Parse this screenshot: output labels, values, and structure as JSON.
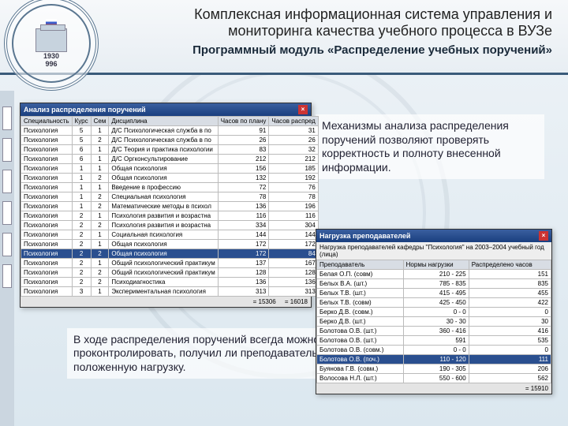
{
  "header": {
    "title": "Комплексная информационная система управления и мониторинга качества учебного процесса в ВУЗе",
    "subtitle": "Программный модуль «Распределение учебных поручений»",
    "emblem_year1": "1930",
    "emblem_year2": "996"
  },
  "desc1": "Механизмы анализа распределения поручений позволяют проверять корректность и полноту внесенной информации.",
  "desc2": "В ходе распределения поручений всегда можно проконтролировать, получил ли преподаватель положенную нагрузку.",
  "win1": {
    "title": "Анализ распределения поручений",
    "close": "×",
    "cols": [
      "Специальность",
      "Курс",
      "Сем",
      "Дисциплина",
      "Часов по плану",
      "Часов распред"
    ],
    "rows": [
      [
        "Психология",
        "5",
        "1",
        "Д/С Психологическая служба в по",
        "91",
        "31"
      ],
      [
        "Психология",
        "5",
        "2",
        "Д/С Психологическая служба в по",
        "26",
        "26"
      ],
      [
        "Психология",
        "6",
        "1",
        "Д/С Теория и практика психологии",
        "83",
        "32"
      ],
      [
        "Психология",
        "6",
        "1",
        "Д/С Оргконсультирование",
        "212",
        "212"
      ],
      [
        "Психология",
        "1",
        "1",
        "Общая психология",
        "156",
        "185"
      ],
      [
        "Психология",
        "1",
        "2",
        "Общая психология",
        "132",
        "192"
      ],
      [
        "Психология",
        "1",
        "1",
        "Введение в профессию",
        "72",
        "76"
      ],
      [
        "Психология",
        "1",
        "2",
        "Специальная психология",
        "78",
        "78"
      ],
      [
        "Психология",
        "1",
        "2",
        "Математические методы в психол",
        "136",
        "196"
      ],
      [
        "Психология",
        "2",
        "1",
        "Психология развития и возрастна",
        "116",
        "116"
      ],
      [
        "Психология",
        "2",
        "2",
        "Психология развития и возрастна",
        "334",
        "304"
      ],
      [
        "Психология",
        "2",
        "1",
        "Социальная психология",
        "144",
        "144"
      ],
      [
        "Психология",
        "2",
        "1",
        "Общая психология",
        "172",
        "172"
      ],
      [
        "Психология",
        "2",
        "2",
        "Общая психология",
        "172",
        "84"
      ],
      [
        "Психология",
        "2",
        "1",
        "Общий психологический практикум",
        "137",
        "167"
      ],
      [
        "Психология",
        "2",
        "2",
        "Общий психологический практикум",
        "128",
        "128"
      ],
      [
        "Психология",
        "2",
        "2",
        "Психодиагностика",
        "136",
        "136"
      ],
      [
        "Психология",
        "3",
        "1",
        "Экспериментальная психология",
        "313",
        "313"
      ]
    ],
    "total1": "= 15306",
    "total2": "= 16018"
  },
  "win2": {
    "title": "Нагрузка преподавателей",
    "subtitle": "Нагрузка преподавателей кафедры \"Психология\" на 2003–2004 учебный год (лица)",
    "close": "×",
    "cols": [
      "Преподаватель",
      "Нормы нагрузки",
      "Распределено часов"
    ],
    "rows": [
      [
        "Белая О.П. (совм)",
        "210 - 225",
        "151"
      ],
      [
        "Белых В.А. (шт.)",
        "785 - 835",
        "835"
      ],
      [
        "Белых Т.В. (шт.)",
        "415 - 495",
        "455"
      ],
      [
        "Белых Т.В. (совм)",
        "425 - 450",
        "422"
      ],
      [
        "Берко Д.В. (совм.)",
        "0 - 0",
        "0"
      ],
      [
        "Берко Д.В. (шт.)",
        "30 - 30",
        "30"
      ],
      [
        "Болотова О.В. (шт.)",
        "360 - 416",
        "416"
      ],
      [
        "Болотова О.В. (шт.)",
        "591",
        "535"
      ],
      [
        "Болотова О.В. (совм.)",
        "0 - 0",
        "0"
      ],
      [
        "Болотова О.В. (поч.)",
        "110 - 120",
        "111"
      ],
      [
        "Буянова Г.В. (совм.)",
        "190 - 305",
        "206"
      ],
      [
        "Волосова Н.Л. (шт.)",
        "550 - 600",
        "562"
      ]
    ],
    "total": "= 15910"
  }
}
